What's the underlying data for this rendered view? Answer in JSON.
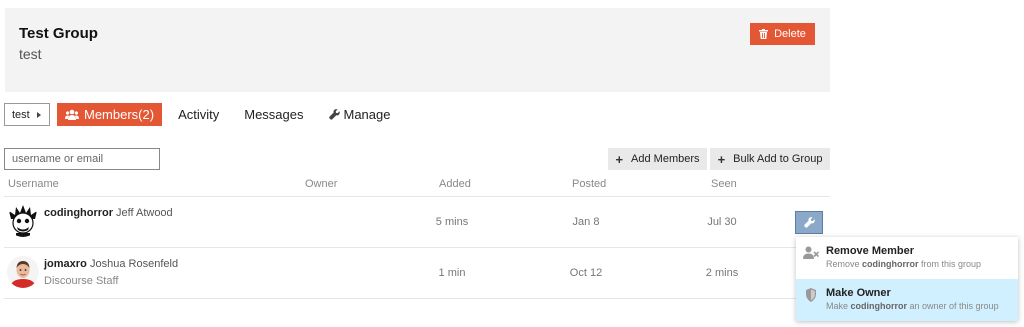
{
  "group": {
    "title": "Test Group",
    "subtitle": "test",
    "delete_label": "Delete"
  },
  "nav": {
    "crumb": "test",
    "tabs": [
      {
        "label": "Members(2)",
        "active": true,
        "icon": "users-icon"
      },
      {
        "label": "Activity"
      },
      {
        "label": "Messages"
      },
      {
        "label": "Manage",
        "icon": "wrench-icon"
      }
    ]
  },
  "toolbar": {
    "search_placeholder": "username or email",
    "add_members": "Add Members",
    "bulk_add": "Bulk Add to Group"
  },
  "table": {
    "headers": [
      "Username",
      "Owner",
      "Added",
      "Posted",
      "Seen"
    ],
    "rows": [
      {
        "username": "codinghorror",
        "name": "Jeff Atwood",
        "title": "",
        "owner": "",
        "added": "5 mins",
        "posted": "Jan 8",
        "seen": "Jul 30"
      },
      {
        "username": "jomaxro",
        "name": "Joshua Rosenfeld",
        "title": "Discourse Staff",
        "owner": "",
        "added": "1 min",
        "posted": "Oct 12",
        "seen": "2 mins"
      }
    ]
  },
  "menu": {
    "items": [
      {
        "title": "Remove Member",
        "desc_prefix": "Remove ",
        "desc_user": "codinghorror",
        "desc_suffix": " from this group",
        "icon": "user-remove-icon"
      },
      {
        "title": "Make Owner",
        "desc_prefix": "Make ",
        "desc_user": "codinghorror",
        "desc_suffix": " an owner of this group",
        "icon": "shield-icon"
      }
    ]
  },
  "colors": {
    "accent": "#e45735",
    "highlight": "#d1f0ff",
    "header_bg": "#f3f3f3"
  }
}
